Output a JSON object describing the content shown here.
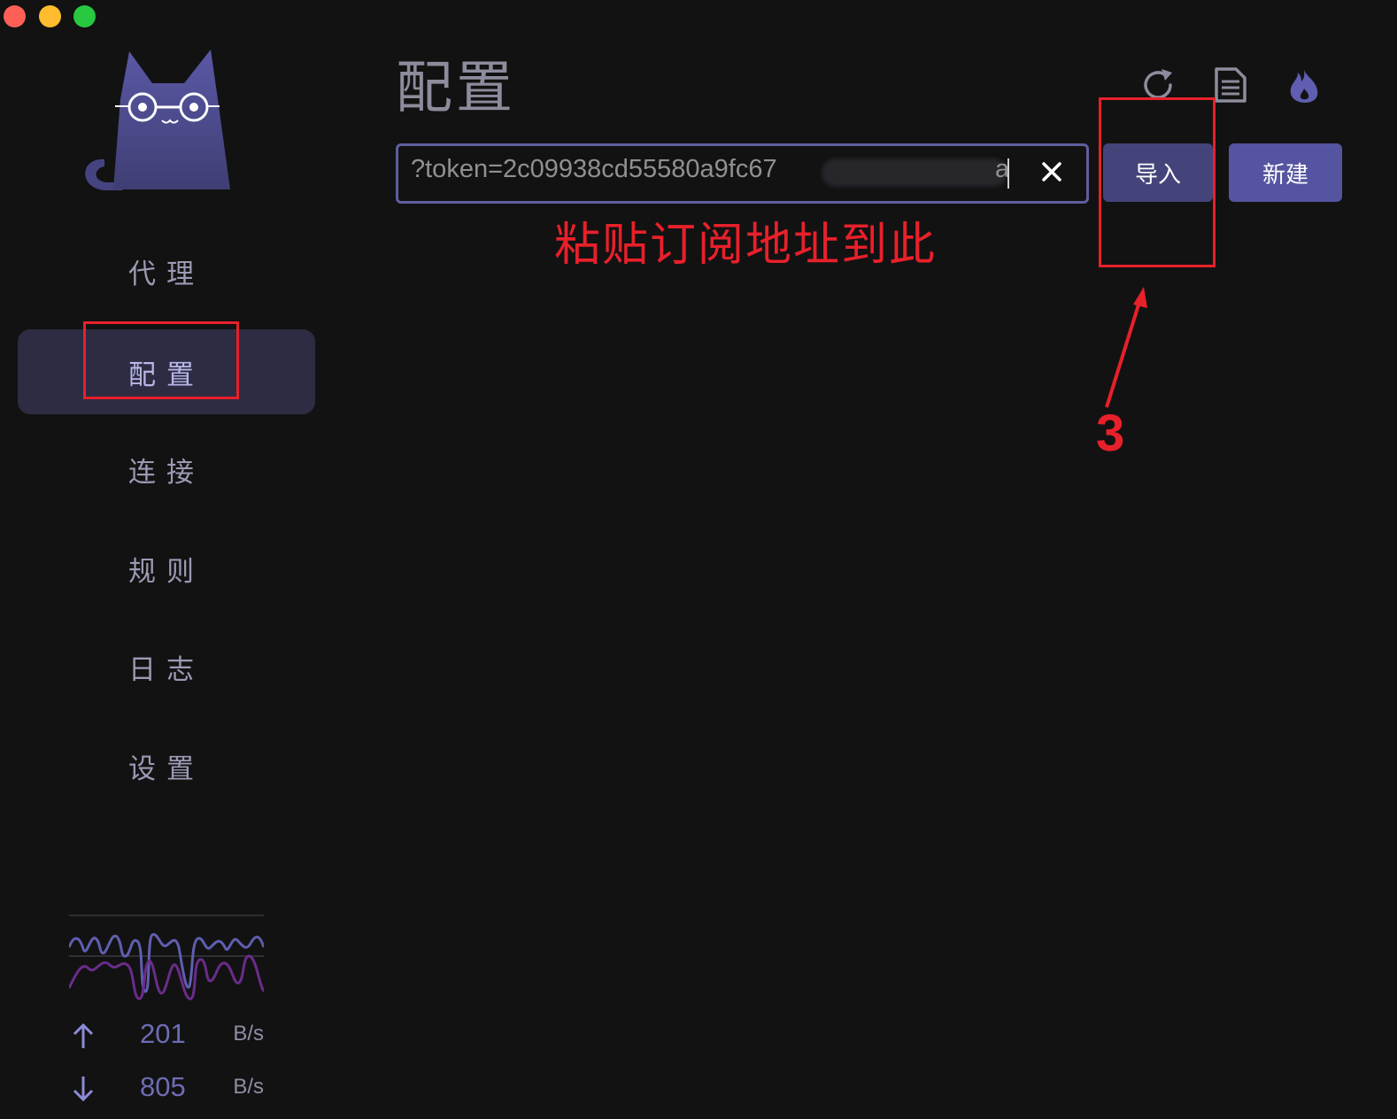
{
  "window": {
    "traffic_lights": [
      "close",
      "minimize",
      "maximize"
    ]
  },
  "sidebar": {
    "logo": "cat-logo",
    "items": [
      {
        "label": "代理",
        "active": false
      },
      {
        "label": "配置",
        "active": true
      },
      {
        "label": "连接",
        "active": false
      },
      {
        "label": "规则",
        "active": false
      },
      {
        "label": "日志",
        "active": false
      },
      {
        "label": "设置",
        "active": false
      }
    ],
    "traffic": {
      "upload_value": "201",
      "upload_unit": "B/s",
      "download_value": "805",
      "download_unit": "B/s",
      "upload_color": "#5f5eb0",
      "download_color": "#6a2c8a"
    }
  },
  "main": {
    "title": "配置",
    "header_icons": [
      "refresh-icon",
      "document-icon",
      "fire-icon"
    ],
    "url_input": {
      "value": "?token=2c09938cd55580a9fc67",
      "trailing_char": "a",
      "placeholder": ""
    },
    "buttons": {
      "import_label": "导入",
      "new_label": "新建"
    }
  },
  "annotations": {
    "paste_hint": "粘贴订阅地址到此",
    "step_number": "3",
    "color": "#e8202a"
  },
  "colors": {
    "background": "#121212",
    "accent": "#5554a0",
    "active_nav_bg": "#2d2c42"
  }
}
